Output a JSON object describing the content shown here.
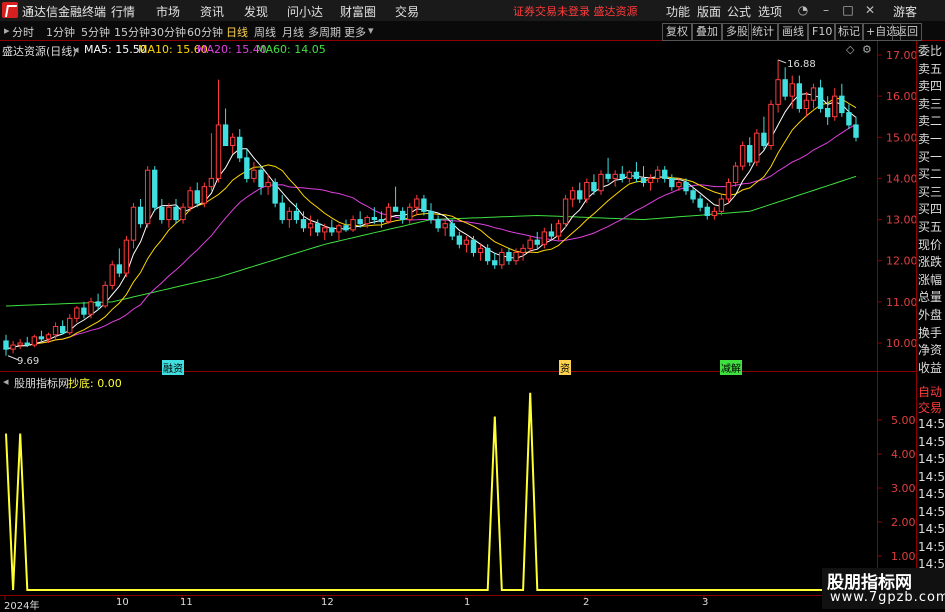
{
  "app": {
    "title": "通达信金融终端",
    "menu": [
      "行情",
      "市场",
      "资讯",
      "发现",
      "问小达",
      "财富圈",
      "交易"
    ],
    "status_link": "证券交易未登录  盛达资源",
    "right_menu": [
      "功能",
      "版面",
      "公式",
      "选项"
    ],
    "guest_label": "游客"
  },
  "toolbar": {
    "periods": [
      "分时",
      "1分钟",
      "5分钟",
      "15分钟",
      "30分钟",
      "60分钟",
      "日线",
      "周线",
      "月线",
      "多周期",
      "更多"
    ],
    "active_period": "日线",
    "right_buttons": [
      "复权",
      "叠加",
      "多股",
      "统计",
      "画线",
      "F10",
      "标记",
      "+自选",
      "返回"
    ]
  },
  "main_panel": {
    "legend_title": "盛达资源(日线)",
    "ma": [
      {
        "label": "MA5: 15.50",
        "color": "#ffffff"
      },
      {
        "label": "MA10: 15.60",
        "color": "#ffd700"
      },
      {
        "label": "MA20: 15.40",
        "color": "#e040e0"
      },
      {
        "label": "MA60: 14.05",
        "color": "#40e040"
      }
    ],
    "high_label": "16.88",
    "low_label": "9.69",
    "events": [
      {
        "label": "融资",
        "color": "#40e0e0"
      },
      {
        "label": "资",
        "color": "#ffd24d"
      },
      {
        "label": "减解",
        "color": "#40e040"
      }
    ]
  },
  "sub_panel": {
    "legend_title": "股朋指标网",
    "indicator": "抄底: 0.00"
  },
  "side_column": [
    "委比",
    "卖五",
    "卖四",
    "卖三",
    "卖二",
    "卖一",
    "买一",
    "买二",
    "买三",
    "买四",
    "买五",
    "现价",
    "涨跌",
    "涨幅",
    "总量",
    "外盘",
    "换手",
    "净资",
    "收益"
  ],
  "side_lower": [
    "自动",
    "交易",
    "14:56",
    "14:56",
    "14:56",
    "14:56",
    "14:56",
    "14:56",
    "14:56",
    "14:56",
    "14:56",
    "14:56",
    "14:56"
  ],
  "date_labels": [
    "2024年",
    "10",
    "11",
    "12",
    "1",
    "2",
    "3"
  ],
  "watermark": {
    "line1": "股朋指标网",
    "line2": "www.7gpzb.com"
  },
  "colors": {
    "up": "#ff3b3b",
    "down": "#40e0e0",
    "border": "#8b0000",
    "ma5": "#ffffff",
    "ma10": "#ffd700",
    "ma20": "#e040e0",
    "ma60": "#40e040",
    "indicator": "#ffff33"
  },
  "chart_data": [
    {
      "type": "candlestick",
      "title": "盛达资源(日线)",
      "y_ticks": [
        10.0,
        11.0,
        12.0,
        13.0,
        14.0,
        15.0,
        16.0,
        17.0
      ],
      "ylim": [
        9.5,
        17.3
      ],
      "candles": [
        {
          "o": 10.05,
          "h": 10.2,
          "l": 9.69,
          "c": 9.85
        },
        {
          "o": 9.85,
          "h": 10.05,
          "l": 9.75,
          "c": 9.95
        },
        {
          "o": 9.95,
          "h": 10.1,
          "l": 9.85,
          "c": 10.0
        },
        {
          "o": 10.0,
          "h": 10.15,
          "l": 9.9,
          "c": 9.95
        },
        {
          "o": 9.95,
          "h": 10.2,
          "l": 9.9,
          "c": 10.15
        },
        {
          "o": 10.15,
          "h": 10.3,
          "l": 10.0,
          "c": 10.1
        },
        {
          "o": 10.1,
          "h": 10.25,
          "l": 10.0,
          "c": 10.2
        },
        {
          "o": 10.2,
          "h": 10.5,
          "l": 10.1,
          "c": 10.4
        },
        {
          "o": 10.4,
          "h": 10.55,
          "l": 10.2,
          "c": 10.25
        },
        {
          "o": 10.25,
          "h": 10.7,
          "l": 10.2,
          "c": 10.6
        },
        {
          "o": 10.6,
          "h": 10.9,
          "l": 10.5,
          "c": 10.85
        },
        {
          "o": 10.85,
          "h": 11.0,
          "l": 10.6,
          "c": 10.7
        },
        {
          "o": 10.7,
          "h": 11.1,
          "l": 10.6,
          "c": 11.0
        },
        {
          "o": 11.0,
          "h": 11.2,
          "l": 10.8,
          "c": 10.9
        },
        {
          "o": 10.9,
          "h": 11.5,
          "l": 10.85,
          "c": 11.4
        },
        {
          "o": 11.4,
          "h": 12.0,
          "l": 11.3,
          "c": 11.9
        },
        {
          "o": 11.9,
          "h": 12.3,
          "l": 11.6,
          "c": 11.7
        },
        {
          "o": 11.7,
          "h": 12.6,
          "l": 11.6,
          "c": 12.5
        },
        {
          "o": 12.5,
          "h": 13.4,
          "l": 12.3,
          "c": 13.3
        },
        {
          "o": 13.3,
          "h": 13.5,
          "l": 12.8,
          "c": 12.9
        },
        {
          "o": 12.9,
          "h": 14.3,
          "l": 12.8,
          "c": 14.2
        },
        {
          "o": 14.2,
          "h": 14.3,
          "l": 13.2,
          "c": 13.3
        },
        {
          "o": 13.3,
          "h": 13.5,
          "l": 12.9,
          "c": 13.0
        },
        {
          "o": 13.0,
          "h": 13.4,
          "l": 12.8,
          "c": 13.3
        },
        {
          "o": 13.3,
          "h": 13.5,
          "l": 12.9,
          "c": 13.0
        },
        {
          "o": 13.0,
          "h": 13.4,
          "l": 12.9,
          "c": 13.3
        },
        {
          "o": 13.3,
          "h": 13.8,
          "l": 13.2,
          "c": 13.7
        },
        {
          "o": 13.7,
          "h": 13.9,
          "l": 13.3,
          "c": 13.4
        },
        {
          "o": 13.4,
          "h": 13.9,
          "l": 13.3,
          "c": 13.8
        },
        {
          "o": 13.8,
          "h": 15.1,
          "l": 13.7,
          "c": 14.0
        },
        {
          "o": 14.0,
          "h": 16.4,
          "l": 13.9,
          "c": 15.3
        },
        {
          "o": 15.3,
          "h": 15.7,
          "l": 14.8,
          "c": 14.8
        },
        {
          "o": 14.8,
          "h": 15.1,
          "l": 14.6,
          "c": 15.0
        },
        {
          "o": 15.0,
          "h": 15.2,
          "l": 14.4,
          "c": 14.5
        },
        {
          "o": 14.5,
          "h": 14.7,
          "l": 13.9,
          "c": 14.0
        },
        {
          "o": 14.0,
          "h": 14.4,
          "l": 13.9,
          "c": 14.2
        },
        {
          "o": 14.2,
          "h": 14.3,
          "l": 13.6,
          "c": 13.8
        },
        {
          "o": 13.8,
          "h": 14.1,
          "l": 13.6,
          "c": 13.9
        },
        {
          "o": 13.9,
          "h": 14.0,
          "l": 13.3,
          "c": 13.4
        },
        {
          "o": 13.4,
          "h": 13.6,
          "l": 12.9,
          "c": 13.0
        },
        {
          "o": 13.0,
          "h": 13.3,
          "l": 12.8,
          "c": 13.2
        },
        {
          "o": 13.2,
          "h": 13.4,
          "l": 12.9,
          "c": 13.0
        },
        {
          "o": 13.0,
          "h": 13.2,
          "l": 12.7,
          "c": 12.8
        },
        {
          "o": 12.8,
          "h": 13.1,
          "l": 12.6,
          "c": 12.9
        },
        {
          "o": 12.9,
          "h": 13.0,
          "l": 12.6,
          "c": 12.7
        },
        {
          "o": 12.7,
          "h": 12.9,
          "l": 12.5,
          "c": 12.8
        },
        {
          "o": 12.8,
          "h": 13.0,
          "l": 12.6,
          "c": 12.7
        },
        {
          "o": 12.7,
          "h": 12.9,
          "l": 12.5,
          "c": 12.85
        },
        {
          "o": 12.85,
          "h": 13.0,
          "l": 12.7,
          "c": 12.75
        },
        {
          "o": 12.75,
          "h": 13.1,
          "l": 12.7,
          "c": 13.0
        },
        {
          "o": 13.0,
          "h": 13.2,
          "l": 12.8,
          "c": 12.9
        },
        {
          "o": 12.9,
          "h": 13.1,
          "l": 12.8,
          "c": 13.05
        },
        {
          "o": 13.05,
          "h": 13.3,
          "l": 12.9,
          "c": 13.0
        },
        {
          "o": 13.0,
          "h": 13.2,
          "l": 12.8,
          "c": 12.95
        },
        {
          "o": 12.95,
          "h": 13.4,
          "l": 12.9,
          "c": 13.3
        },
        {
          "o": 13.3,
          "h": 13.8,
          "l": 13.2,
          "c": 13.2
        },
        {
          "o": 13.2,
          "h": 13.3,
          "l": 12.9,
          "c": 13.0
        },
        {
          "o": 13.0,
          "h": 13.4,
          "l": 12.9,
          "c": 13.3
        },
        {
          "o": 13.3,
          "h": 13.6,
          "l": 13.1,
          "c": 13.5
        },
        {
          "o": 13.5,
          "h": 13.6,
          "l": 13.1,
          "c": 13.2
        },
        {
          "o": 13.2,
          "h": 13.4,
          "l": 12.9,
          "c": 13.0
        },
        {
          "o": 13.0,
          "h": 13.1,
          "l": 12.7,
          "c": 12.8
        },
        {
          "o": 12.8,
          "h": 13.0,
          "l": 12.6,
          "c": 12.9
        },
        {
          "o": 12.9,
          "h": 13.0,
          "l": 12.5,
          "c": 12.6
        },
        {
          "o": 12.6,
          "h": 12.7,
          "l": 12.3,
          "c": 12.4
        },
        {
          "o": 12.4,
          "h": 12.6,
          "l": 12.2,
          "c": 12.5
        },
        {
          "o": 12.5,
          "h": 12.6,
          "l": 12.1,
          "c": 12.2
        },
        {
          "o": 12.2,
          "h": 12.4,
          "l": 12.0,
          "c": 12.3
        },
        {
          "o": 12.3,
          "h": 12.4,
          "l": 11.9,
          "c": 12.0
        },
        {
          "o": 12.0,
          "h": 12.2,
          "l": 11.8,
          "c": 11.9
        },
        {
          "o": 11.9,
          "h": 12.3,
          "l": 11.8,
          "c": 12.2
        },
        {
          "o": 12.2,
          "h": 12.3,
          "l": 11.9,
          "c": 12.0
        },
        {
          "o": 12.0,
          "h": 12.3,
          "l": 11.9,
          "c": 12.2
        },
        {
          "o": 12.2,
          "h": 12.4,
          "l": 12.0,
          "c": 12.3
        },
        {
          "o": 12.3,
          "h": 12.6,
          "l": 12.2,
          "c": 12.5
        },
        {
          "o": 12.5,
          "h": 12.7,
          "l": 12.3,
          "c": 12.4
        },
        {
          "o": 12.4,
          "h": 12.8,
          "l": 12.3,
          "c": 12.7
        },
        {
          "o": 12.7,
          "h": 12.9,
          "l": 12.5,
          "c": 12.6
        },
        {
          "o": 12.6,
          "h": 13.0,
          "l": 12.5,
          "c": 12.9
        },
        {
          "o": 12.9,
          "h": 13.6,
          "l": 12.8,
          "c": 13.5
        },
        {
          "o": 13.5,
          "h": 13.8,
          "l": 13.3,
          "c": 13.7
        },
        {
          "o": 13.7,
          "h": 13.9,
          "l": 13.4,
          "c": 13.5
        },
        {
          "o": 13.5,
          "h": 14.0,
          "l": 13.4,
          "c": 13.9
        },
        {
          "o": 13.9,
          "h": 14.1,
          "l": 13.6,
          "c": 13.7
        },
        {
          "o": 13.7,
          "h": 14.2,
          "l": 13.6,
          "c": 14.1
        },
        {
          "o": 14.1,
          "h": 14.5,
          "l": 13.9,
          "c": 14.0
        },
        {
          "o": 14.0,
          "h": 14.2,
          "l": 13.8,
          "c": 14.1
        },
        {
          "o": 14.1,
          "h": 14.3,
          "l": 13.9,
          "c": 14.0
        },
        {
          "o": 14.0,
          "h": 14.2,
          "l": 13.9,
          "c": 14.15
        },
        {
          "o": 14.15,
          "h": 14.4,
          "l": 13.9,
          "c": 14.0
        },
        {
          "o": 14.0,
          "h": 14.3,
          "l": 13.8,
          "c": 13.9
        },
        {
          "o": 13.9,
          "h": 14.1,
          "l": 13.7,
          "c": 14.0
        },
        {
          "o": 14.0,
          "h": 14.3,
          "l": 13.9,
          "c": 14.2
        },
        {
          "o": 14.2,
          "h": 14.3,
          "l": 13.9,
          "c": 14.0
        },
        {
          "o": 14.0,
          "h": 14.1,
          "l": 13.7,
          "c": 13.8
        },
        {
          "o": 13.8,
          "h": 14.0,
          "l": 13.7,
          "c": 13.9
        },
        {
          "o": 13.9,
          "h": 14.0,
          "l": 13.6,
          "c": 13.7
        },
        {
          "o": 13.7,
          "h": 13.8,
          "l": 13.4,
          "c": 13.5
        },
        {
          "o": 13.5,
          "h": 13.6,
          "l": 13.2,
          "c": 13.3
        },
        {
          "o": 13.3,
          "h": 13.4,
          "l": 13.0,
          "c": 13.1
        },
        {
          "o": 13.1,
          "h": 13.3,
          "l": 13.0,
          "c": 13.2
        },
        {
          "o": 13.2,
          "h": 13.6,
          "l": 13.1,
          "c": 13.5
        },
        {
          "o": 13.5,
          "h": 14.0,
          "l": 13.4,
          "c": 13.9
        },
        {
          "o": 13.9,
          "h": 14.4,
          "l": 13.8,
          "c": 14.3
        },
        {
          "o": 14.3,
          "h": 14.9,
          "l": 14.2,
          "c": 14.8
        },
        {
          "o": 14.8,
          "h": 15.0,
          "l": 14.3,
          "c": 14.4
        },
        {
          "o": 14.4,
          "h": 15.2,
          "l": 14.3,
          "c": 15.1
        },
        {
          "o": 15.1,
          "h": 15.5,
          "l": 14.7,
          "c": 14.8
        },
        {
          "o": 14.8,
          "h": 15.9,
          "l": 14.7,
          "c": 15.8
        },
        {
          "o": 15.8,
          "h": 16.88,
          "l": 15.6,
          "c": 16.4
        },
        {
          "o": 16.4,
          "h": 16.7,
          "l": 15.9,
          "c": 16.0
        },
        {
          "o": 16.0,
          "h": 16.5,
          "l": 15.7,
          "c": 16.3
        },
        {
          "o": 16.3,
          "h": 16.5,
          "l": 15.6,
          "c": 15.7
        },
        {
          "o": 15.7,
          "h": 16.1,
          "l": 15.5,
          "c": 15.9
        },
        {
          "o": 15.9,
          "h": 16.3,
          "l": 15.7,
          "c": 16.2
        },
        {
          "o": 16.2,
          "h": 16.4,
          "l": 15.6,
          "c": 15.7
        },
        {
          "o": 15.7,
          "h": 16.0,
          "l": 15.3,
          "c": 15.5
        },
        {
          "o": 15.5,
          "h": 16.2,
          "l": 15.4,
          "c": 16.0
        },
        {
          "o": 16.0,
          "h": 16.3,
          "l": 15.5,
          "c": 15.6
        },
        {
          "o": 15.6,
          "h": 15.8,
          "l": 15.2,
          "c": 15.3
        },
        {
          "o": 15.3,
          "h": 15.5,
          "l": 14.9,
          "c": 15.0
        }
      ],
      "ma60_anchor": [
        10.9,
        11.0,
        11.6,
        12.4,
        13.0,
        13.1,
        13.0,
        13.2,
        14.05
      ]
    },
    {
      "type": "line",
      "title": "股朋指标网",
      "series": [
        {
          "name": "抄底",
          "values": [
            4.6,
            0,
            4.6,
            0,
            0,
            0,
            0,
            0,
            0,
            0,
            0,
            0,
            0,
            0,
            0,
            0,
            0,
            0,
            0,
            0,
            0,
            0,
            0,
            0,
            0,
            0,
            0,
            0,
            0,
            0,
            0,
            0,
            0,
            0,
            0,
            0,
            0,
            0,
            0,
            0,
            0,
            0,
            0,
            0,
            0,
            0,
            0,
            0,
            0,
            0,
            0,
            0,
            0,
            0,
            0,
            0,
            0,
            0,
            0,
            0,
            0,
            0,
            0,
            0,
            0,
            0,
            0,
            0,
            0,
            0,
            0,
            0,
            0,
            0,
            0,
            0,
            0,
            0,
            0,
            0,
            0,
            0,
            0,
            0,
            0,
            0,
            0,
            0,
            0,
            0,
            0,
            0,
            0,
            0,
            0,
            0,
            0,
            0,
            0,
            0,
            0,
            0,
            0,
            0,
            0,
            0,
            0,
            0,
            0,
            0,
            0,
            0,
            0,
            0,
            0,
            0,
            0,
            0,
            0,
            0,
            0
          ]
        }
      ],
      "spikes": [
        {
          "x": 0,
          "v": 4.6
        },
        {
          "x": 2,
          "v": 4.6
        },
        {
          "x": 69,
          "v": 5.1
        },
        {
          "x": 74,
          "v": 5.8
        }
      ],
      "y_ticks": [
        1.0,
        2.0,
        3.0,
        4.0,
        5.0
      ],
      "ylim": [
        0,
        6.2
      ]
    }
  ]
}
